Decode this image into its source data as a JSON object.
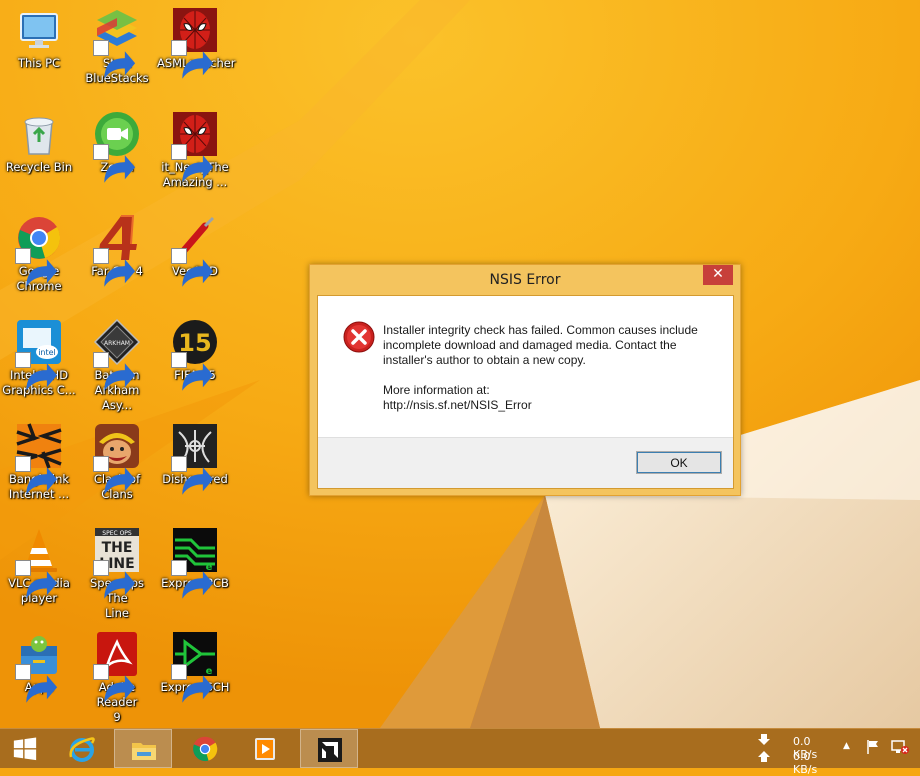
{
  "desktop": {
    "icons": [
      {
        "label": "This PC",
        "icon": "this-pc-icon"
      },
      {
        "label": "Start\nBlueStacks",
        "icon": "bluestacks-icon"
      },
      {
        "label": "ASMLauncher",
        "icon": "spiderman-icon"
      },
      {
        "label": "Recycle Bin",
        "icon": "recycle-bin-icon"
      },
      {
        "label": "Zoom",
        "icon": "zoom-icon"
      },
      {
        "label": "it_Next_The\nAmazing ...",
        "icon": "spiderman-icon"
      },
      {
        "label": "Google\nChrome",
        "icon": "chrome-icon"
      },
      {
        "label": "Far Cry 4",
        "icon": "farcry-icon"
      },
      {
        "label": "VeeCAD",
        "icon": "veecad-icon"
      },
      {
        "label": "Intel® HD\nGraphics C...",
        "icon": "intel-graphics-icon"
      },
      {
        "label": "Batman\nArkham Asy...",
        "icon": "batman-arkham-icon"
      },
      {
        "label": "FIFA 15",
        "icon": "fifa-icon"
      },
      {
        "label": "Banglalink\nInternet ...",
        "icon": "banglalink-icon"
      },
      {
        "label": "Clash of\nClans",
        "icon": "clash-of-clans-icon"
      },
      {
        "label": "Dishonored",
        "icon": "dishonored-icon"
      },
      {
        "label": "VLC media\nplayer",
        "icon": "vlc-icon"
      },
      {
        "label": "Spec Ops The\nLine",
        "icon": "spec-ops-icon"
      },
      {
        "label": "ExpressPCB",
        "icon": "expresspcb-icon"
      },
      {
        "label": "Apps",
        "icon": "apps-icon"
      },
      {
        "label": "Adobe Reader\n9",
        "icon": "adobe-reader-icon"
      },
      {
        "label": "ExpressSCH",
        "icon": "expresssch-icon"
      }
    ]
  },
  "dialog": {
    "title": "NSIS Error",
    "close_label": "✕",
    "message": "Installer integrity check has failed. Common causes include incomplete download and damaged media. Contact the installer's author to obtain a new copy.",
    "more_info_label": "More information at:",
    "more_info_url": "http://nsis.sf.net/NSIS_Error",
    "ok_label": "OK"
  },
  "taskbar": {
    "upload_speed": "0.0 KB/s",
    "download_speed": "0.0 KB/s",
    "tray_chevron": "▲"
  },
  "colors": {
    "desktop_orange": "#f6a712",
    "taskbar": "#a86d1e",
    "dialog_frame": "#f4c45e",
    "close_red": "#c7403a"
  }
}
